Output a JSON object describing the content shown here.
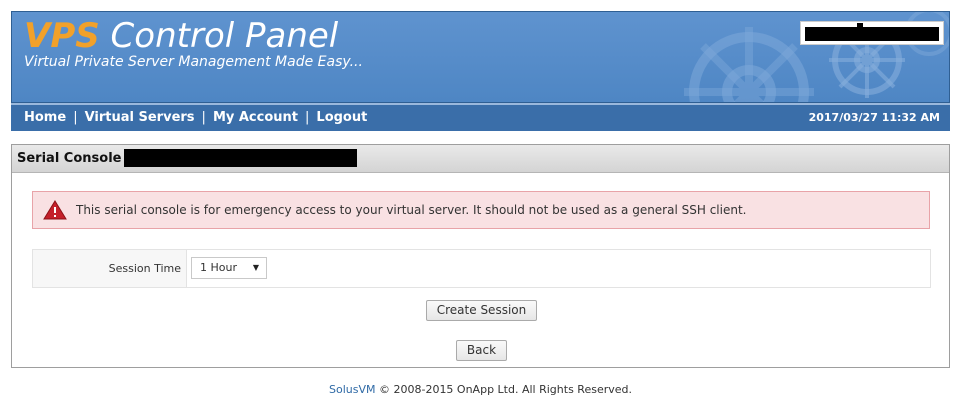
{
  "header": {
    "logo_accent": "VPS",
    "logo_main": " Control Panel",
    "tagline": "Virtual Private Server Management Made Easy...",
    "accent_color": "#f2a12a",
    "background_color": "#5a8fcc"
  },
  "nav": {
    "items": [
      {
        "label": "Home"
      },
      {
        "label": "Virtual Servers"
      },
      {
        "label": "My Account"
      },
      {
        "label": "Logout"
      }
    ],
    "separator": "|",
    "datetime": "2017/03/27 11:32 AM"
  },
  "panel": {
    "title": "Serial Console",
    "alert": {
      "icon": "warning-triangle-icon",
      "text": "This serial console is for emergency access to your virtual server. It should not be used as a general SSH client."
    },
    "form": {
      "session_time_label": "Session Time",
      "session_time_value": "1 Hour"
    },
    "create_button_label": "Create Session",
    "back_button_label": "Back"
  },
  "footer": {
    "link_text": "SolusVM",
    "copyright": " © 2008-2015 OnApp Ltd. All Rights Reserved."
  }
}
